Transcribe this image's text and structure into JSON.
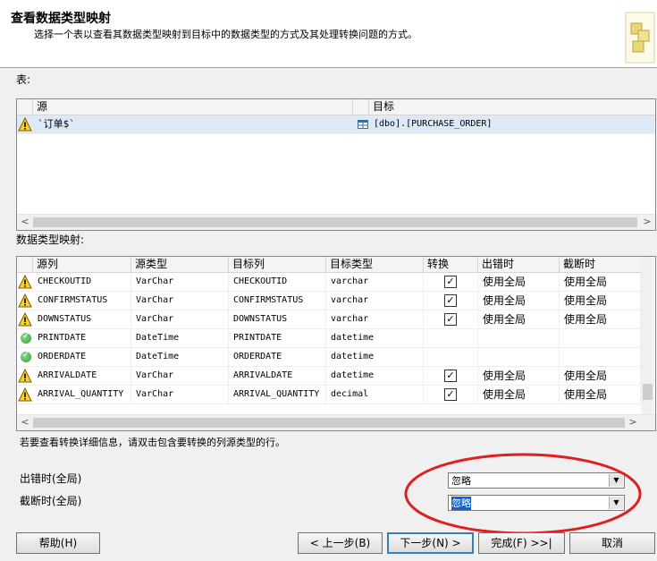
{
  "header": {
    "title": "查看数据类型映射",
    "subtitle": "选择一个表以查看其数据类型映射到目标中的数据类型的方式及其处理转换问题的方式。"
  },
  "tables_section": {
    "label": "表:",
    "columns": [
      "源",
      "目标"
    ],
    "rows": [
      {
        "status": "warning-icon",
        "source": "`订单$`",
        "target": "[dbo].[PURCHASE_ORDER]"
      }
    ]
  },
  "mapping_section": {
    "label": "数据类型映射:",
    "columns": [
      "源列",
      "源类型",
      "目标列",
      "目标类型",
      "转换",
      "出错时",
      "截断时"
    ],
    "rows": [
      {
        "status": "warning-icon",
        "src_col": "CHECKOUTID",
        "src_type": "VarChar",
        "dst_col": "CHECKOUTID",
        "dst_type": "varchar",
        "convert": true,
        "on_error": "使用全局",
        "on_trunc": "使用全局"
      },
      {
        "status": "warning-icon",
        "src_col": "CONFIRMSTATUS",
        "src_type": "VarChar",
        "dst_col": "CONFIRMSTATUS",
        "dst_type": "varchar",
        "convert": true,
        "on_error": "使用全局",
        "on_trunc": "使用全局"
      },
      {
        "status": "warning-icon",
        "src_col": "DOWNSTATUS",
        "src_type": "VarChar",
        "dst_col": "DOWNSTATUS",
        "dst_type": "varchar",
        "convert": true,
        "on_error": "使用全局",
        "on_trunc": "使用全局"
      },
      {
        "status": "ok-icon",
        "src_col": "PRINTDATE",
        "src_type": "DateTime",
        "dst_col": "PRINTDATE",
        "dst_type": "datetime",
        "convert": false,
        "on_error": "",
        "on_trunc": ""
      },
      {
        "status": "ok-icon",
        "src_col": "ORDERDATE",
        "src_type": "DateTime",
        "dst_col": "ORDERDATE",
        "dst_type": "datetime",
        "convert": false,
        "on_error": "",
        "on_trunc": ""
      },
      {
        "status": "warning-icon",
        "src_col": "ARRIVALDATE",
        "src_type": "VarChar",
        "dst_col": "ARRIVALDATE",
        "dst_type": "datetime",
        "convert": true,
        "on_error": "使用全局",
        "on_trunc": "使用全局"
      },
      {
        "status": "warning-icon",
        "src_col": "ARRIVAL_QUANTITY",
        "src_type": "VarChar",
        "dst_col": "ARRIVAL_QUANTITY",
        "dst_type": "decimal",
        "convert": true,
        "on_error": "使用全局",
        "on_trunc": "使用全局"
      }
    ]
  },
  "hint": "若要查看转换详细信息，请双击包含要转换的列源类型的行。",
  "global": {
    "on_error_label": "出错时(全局)",
    "on_error_value": "忽略",
    "on_trunc_label": "截断时(全局)",
    "on_trunc_value": "忽略"
  },
  "buttons": {
    "help": "帮助(H)",
    "back": "< 上一步(B)",
    "next": "下一步(N) >",
    "finish": "完成(F) >>|",
    "cancel": "取消"
  },
  "accent": "#e02020",
  "selection_color": "#0a64d6"
}
